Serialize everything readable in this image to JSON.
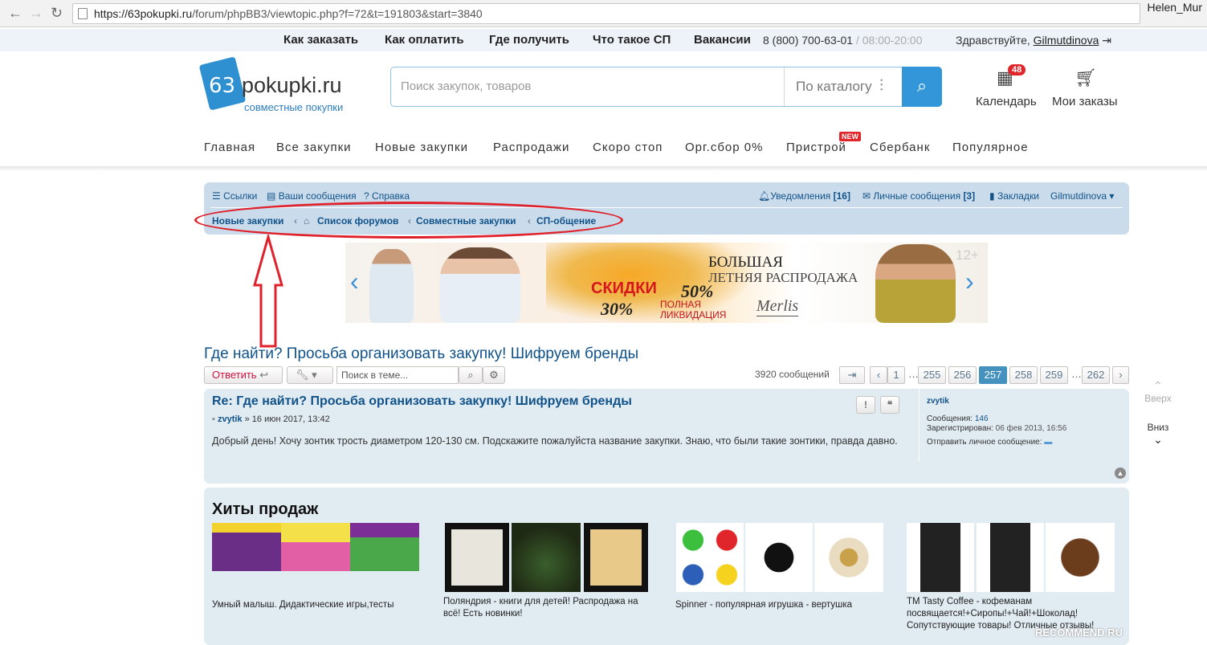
{
  "browser": {
    "url_host": "https://63pokupki.ru",
    "url_path": "/forum/phpBB3/viewtopic.php?f=72&t=191803&start=3840",
    "profile_name": "Helen_Mur"
  },
  "topmenu": {
    "items": [
      "Как заказать",
      "Как оплатить",
      "Где получить",
      "Что такое СП",
      "Вакансии"
    ],
    "phone": "8 (800) 700-63-01",
    "hours": " / 08:00-20:00",
    "greeting": "Здравствуйте, ",
    "user": "Gilmutdinova"
  },
  "header": {
    "logo_number": "63",
    "logo_name": "pokupki.ru",
    "logo_sub": "совместные покупки",
    "search_placeholder": "Поиск закупок, товаров",
    "catalog_label": "По каталогу",
    "calendar_label": "Календарь",
    "calendar_badge": "48",
    "orders_label": "Мои заказы"
  },
  "mainnav": {
    "items": [
      "Главная",
      "Все закупки",
      "Новые закупки",
      "Распродажи",
      "Скоро стоп",
      "Орг.сбор 0%",
      "Пристрой",
      "Сбербанк",
      "Популярное"
    ],
    "new_badge": "NEW"
  },
  "forumbar": {
    "links_left": [
      "Ссылки",
      "Ваши сообщения",
      "Справка"
    ],
    "notifications": "Уведомления",
    "notifications_count": "[16]",
    "messages": "Личные сообщения",
    "messages_count": "[3]",
    "bookmarks": "Закладки",
    "user": "Gilmutdinova",
    "breadcrumbs": [
      "Новые закупки",
      "Список форумов",
      "Совместные закупки",
      "СП-общение"
    ]
  },
  "banner": {
    "title": "БОЛЬШАЯ",
    "subtitle": "ЛЕТНЯЯ РАСПРОДАЖА",
    "discount_label": "СКИДКИ",
    "discount_30": "30%",
    "discount_50": "50%",
    "liquidation": "ПОЛНАЯ ЛИКВИДАЦИЯ",
    "brand": "Merlis",
    "age": "12+"
  },
  "topic": {
    "title": "Где найти? Просьба организовать закупку! Шифруем бренды",
    "reply_label": "Ответить",
    "search_placeholder": "Поиск в теме...",
    "post_count": "3920 сообщений",
    "pages": [
      "1",
      "255",
      "256",
      "257",
      "258",
      "259",
      "262"
    ],
    "current_page": "257",
    "dots": "…"
  },
  "post": {
    "title": "Re: Где найти? Просьба организовать закупку! Шифруем бренды",
    "author": "zvytik",
    "date": " » 16 июн 2017, 13:42",
    "body": "Добрый день! Хочу зонтик трость диаметром 120-130 см. Подскажите пожалуйста название закупки. Знаю, что были такие зонтики, правда давно.",
    "profile_name": "zvytik",
    "posts_label": "Сообщения: ",
    "posts_value": "146",
    "registered_label": "Зарегистрирован: ",
    "registered_value": "06 фев 2013, 16:56",
    "pm_label": "Отправить личное сообщение:"
  },
  "side": {
    "up_label": "Вверх",
    "down_label": "Вниз"
  },
  "hits": {
    "title": "Хиты продаж",
    "items": [
      {
        "caption": "Умный малыш. Дидактические игры,тесты"
      },
      {
        "caption": "Поляндрия - книги для детей! Распродажа на всё! Есть новинки!"
      },
      {
        "caption": "Spinner - популярная игрушка - вертушка"
      },
      {
        "caption": "ТМ Tasty Coffee - кофеманам посвящается!+Сиропы!+Чай!+Шоколад! Сопутствующие товары! Отличные отзывы!"
      }
    ]
  },
  "watermark": "RECOMMEND.RU"
}
